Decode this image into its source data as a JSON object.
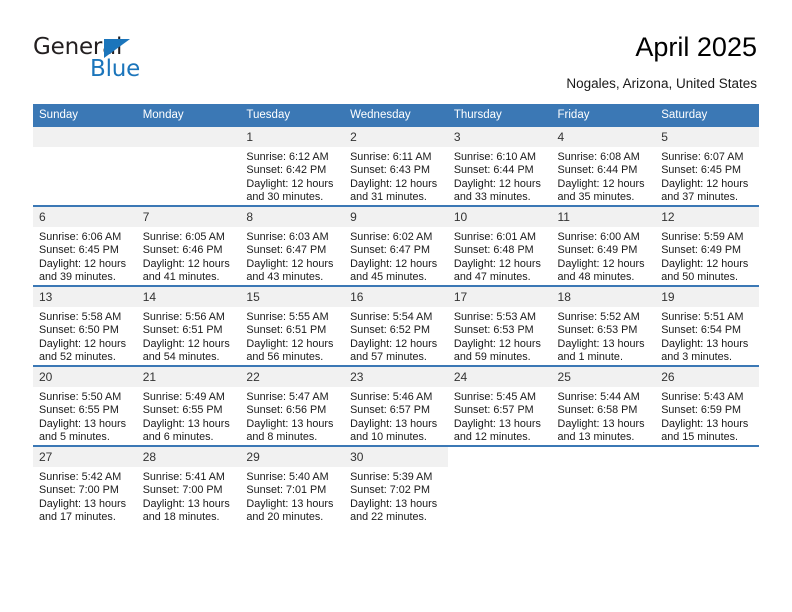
{
  "brand": {
    "name_top": "General",
    "name_bottom": "Blue",
    "color_dark": "#231f20",
    "color_blue": "#1b75bb"
  },
  "header": {
    "title": "April 2025",
    "subtitle": "Nogales, Arizona, United States"
  },
  "theme": {
    "header_bg": "#3b78b5",
    "daynum_bg": "#f1f1f1",
    "cell_bg": "#ffffff",
    "text": "#1a1a1a"
  },
  "calendar": {
    "weekday_headers": [
      "Sunday",
      "Monday",
      "Tuesday",
      "Wednesday",
      "Thursday",
      "Friday",
      "Saturday"
    ],
    "weeks": [
      [
        {
          "day": "",
          "type": "empty",
          "lines": []
        },
        {
          "day": "",
          "type": "empty",
          "lines": []
        },
        {
          "day": "1",
          "type": "day",
          "lines": [
            "Sunrise: 6:12 AM",
            "Sunset: 6:42 PM",
            "Daylight: 12 hours",
            "and 30 minutes."
          ]
        },
        {
          "day": "2",
          "type": "day",
          "lines": [
            "Sunrise: 6:11 AM",
            "Sunset: 6:43 PM",
            "Daylight: 12 hours",
            "and 31 minutes."
          ]
        },
        {
          "day": "3",
          "type": "day",
          "lines": [
            "Sunrise: 6:10 AM",
            "Sunset: 6:44 PM",
            "Daylight: 12 hours",
            "and 33 minutes."
          ]
        },
        {
          "day": "4",
          "type": "day",
          "lines": [
            "Sunrise: 6:08 AM",
            "Sunset: 6:44 PM",
            "Daylight: 12 hours",
            "and 35 minutes."
          ]
        },
        {
          "day": "5",
          "type": "day",
          "lines": [
            "Sunrise: 6:07 AM",
            "Sunset: 6:45 PM",
            "Daylight: 12 hours",
            "and 37 minutes."
          ]
        }
      ],
      [
        {
          "day": "6",
          "type": "day",
          "lines": [
            "Sunrise: 6:06 AM",
            "Sunset: 6:45 PM",
            "Daylight: 12 hours",
            "and 39 minutes."
          ]
        },
        {
          "day": "7",
          "type": "day",
          "lines": [
            "Sunrise: 6:05 AM",
            "Sunset: 6:46 PM",
            "Daylight: 12 hours",
            "and 41 minutes."
          ]
        },
        {
          "day": "8",
          "type": "day",
          "lines": [
            "Sunrise: 6:03 AM",
            "Sunset: 6:47 PM",
            "Daylight: 12 hours",
            "and 43 minutes."
          ]
        },
        {
          "day": "9",
          "type": "day",
          "lines": [
            "Sunrise: 6:02 AM",
            "Sunset: 6:47 PM",
            "Daylight: 12 hours",
            "and 45 minutes."
          ]
        },
        {
          "day": "10",
          "type": "day",
          "lines": [
            "Sunrise: 6:01 AM",
            "Sunset: 6:48 PM",
            "Daylight: 12 hours",
            "and 47 minutes."
          ]
        },
        {
          "day": "11",
          "type": "day",
          "lines": [
            "Sunrise: 6:00 AM",
            "Sunset: 6:49 PM",
            "Daylight: 12 hours",
            "and 48 minutes."
          ]
        },
        {
          "day": "12",
          "type": "day",
          "lines": [
            "Sunrise: 5:59 AM",
            "Sunset: 6:49 PM",
            "Daylight: 12 hours",
            "and 50 minutes."
          ]
        }
      ],
      [
        {
          "day": "13",
          "type": "day",
          "lines": [
            "Sunrise: 5:58 AM",
            "Sunset: 6:50 PM",
            "Daylight: 12 hours",
            "and 52 minutes."
          ]
        },
        {
          "day": "14",
          "type": "day",
          "lines": [
            "Sunrise: 5:56 AM",
            "Sunset: 6:51 PM",
            "Daylight: 12 hours",
            "and 54 minutes."
          ]
        },
        {
          "day": "15",
          "type": "day",
          "lines": [
            "Sunrise: 5:55 AM",
            "Sunset: 6:51 PM",
            "Daylight: 12 hours",
            "and 56 minutes."
          ]
        },
        {
          "day": "16",
          "type": "day",
          "lines": [
            "Sunrise: 5:54 AM",
            "Sunset: 6:52 PM",
            "Daylight: 12 hours",
            "and 57 minutes."
          ]
        },
        {
          "day": "17",
          "type": "day",
          "lines": [
            "Sunrise: 5:53 AM",
            "Sunset: 6:53 PM",
            "Daylight: 12 hours",
            "and 59 minutes."
          ]
        },
        {
          "day": "18",
          "type": "day",
          "lines": [
            "Sunrise: 5:52 AM",
            "Sunset: 6:53 PM",
            "Daylight: 13 hours",
            "and 1 minute."
          ]
        },
        {
          "day": "19",
          "type": "day",
          "lines": [
            "Sunrise: 5:51 AM",
            "Sunset: 6:54 PM",
            "Daylight: 13 hours",
            "and 3 minutes."
          ]
        }
      ],
      [
        {
          "day": "20",
          "type": "day",
          "lines": [
            "Sunrise: 5:50 AM",
            "Sunset: 6:55 PM",
            "Daylight: 13 hours",
            "and 5 minutes."
          ]
        },
        {
          "day": "21",
          "type": "day",
          "lines": [
            "Sunrise: 5:49 AM",
            "Sunset: 6:55 PM",
            "Daylight: 13 hours",
            "and 6 minutes."
          ]
        },
        {
          "day": "22",
          "type": "day",
          "lines": [
            "Sunrise: 5:47 AM",
            "Sunset: 6:56 PM",
            "Daylight: 13 hours",
            "and 8 minutes."
          ]
        },
        {
          "day": "23",
          "type": "day",
          "lines": [
            "Sunrise: 5:46 AM",
            "Sunset: 6:57 PM",
            "Daylight: 13 hours",
            "and 10 minutes."
          ]
        },
        {
          "day": "24",
          "type": "day",
          "lines": [
            "Sunrise: 5:45 AM",
            "Sunset: 6:57 PM",
            "Daylight: 13 hours",
            "and 12 minutes."
          ]
        },
        {
          "day": "25",
          "type": "day",
          "lines": [
            "Sunrise: 5:44 AM",
            "Sunset: 6:58 PM",
            "Daylight: 13 hours",
            "and 13 minutes."
          ]
        },
        {
          "day": "26",
          "type": "day",
          "lines": [
            "Sunrise: 5:43 AM",
            "Sunset: 6:59 PM",
            "Daylight: 13 hours",
            "and 15 minutes."
          ]
        }
      ],
      [
        {
          "day": "27",
          "type": "day",
          "lines": [
            "Sunrise: 5:42 AM",
            "Sunset: 7:00 PM",
            "Daylight: 13 hours",
            "and 17 minutes."
          ]
        },
        {
          "day": "28",
          "type": "day",
          "lines": [
            "Sunrise: 5:41 AM",
            "Sunset: 7:00 PM",
            "Daylight: 13 hours",
            "and 18 minutes."
          ]
        },
        {
          "day": "29",
          "type": "day",
          "lines": [
            "Sunrise: 5:40 AM",
            "Sunset: 7:01 PM",
            "Daylight: 13 hours",
            "and 20 minutes."
          ]
        },
        {
          "day": "30",
          "type": "day",
          "lines": [
            "Sunrise: 5:39 AM",
            "Sunset: 7:02 PM",
            "Daylight: 13 hours",
            "and 22 minutes."
          ]
        },
        {
          "day": "",
          "type": "blank",
          "lines": []
        },
        {
          "day": "",
          "type": "blank",
          "lines": []
        },
        {
          "day": "",
          "type": "blank",
          "lines": []
        }
      ]
    ]
  }
}
